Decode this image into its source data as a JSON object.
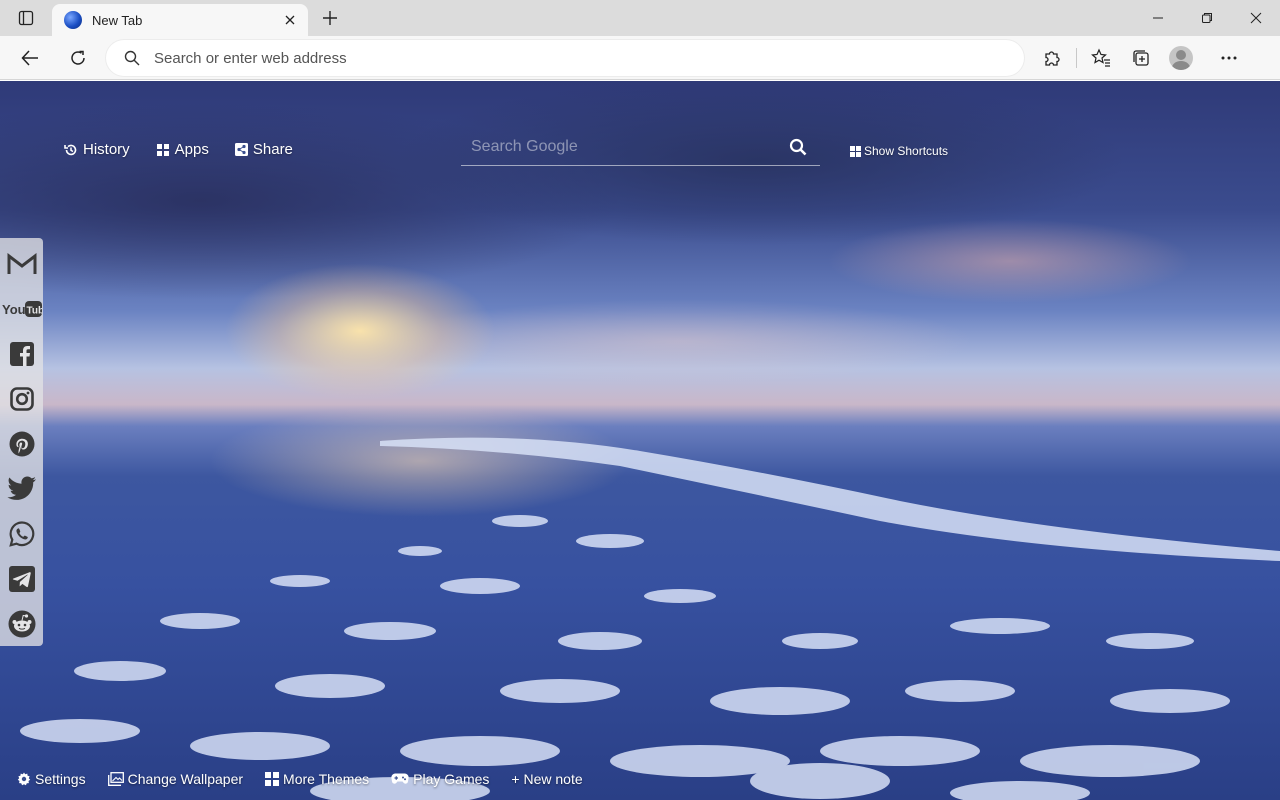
{
  "tab": {
    "title": "New Tab"
  },
  "toolbar": {
    "address_placeholder": "Search or enter web address"
  },
  "topnav": {
    "history": "History",
    "apps": "Apps",
    "share": "Share"
  },
  "search": {
    "placeholder": "Search Google"
  },
  "shortcuts_label": "Show Shortcuts",
  "sidebar": [
    "gmail-icon",
    "youtube-icon",
    "facebook-icon",
    "instagram-icon",
    "pinterest-icon",
    "twitter-icon",
    "whatsapp-icon",
    "telegram-icon",
    "reddit-icon"
  ],
  "bottombar": {
    "settings": "Settings",
    "change_wallpaper": "Change Wallpaper",
    "more_themes": "More Themes",
    "play_games": "Play Games",
    "new_note": "+ New note"
  }
}
